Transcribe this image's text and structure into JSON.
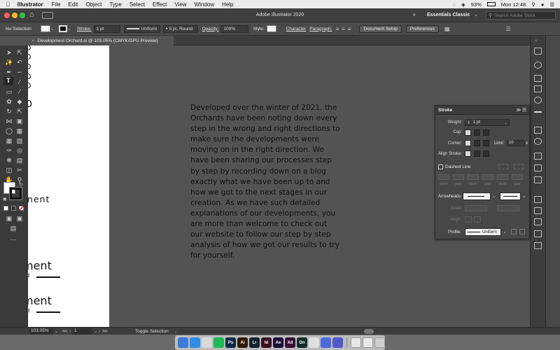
{
  "menubar": {
    "app_name": "Illustrator",
    "items": [
      "File",
      "Edit",
      "Object",
      "Type",
      "Select",
      "Effect",
      "View",
      "Window",
      "Help"
    ],
    "battery": "93%",
    "clock": "Mon 12:48"
  },
  "titlebar": {
    "title": "Adobe Illustrator 2020",
    "workspace": "Essentials Classic",
    "search_placeholder": "Search Adobe Stock"
  },
  "controlbar": {
    "selection": "No Selection",
    "stroke_label": "Stroke:",
    "stroke_weight": "1 pt",
    "profile": "Uniform",
    "brush": "5 pt. Round",
    "opacity_label": "Opacity:",
    "opacity": "100%",
    "style_label": "Style:",
    "character": "Character",
    "paragraph": "Paragraph:",
    "document_setup": "Document Setup",
    "preferences": "Preferences"
  },
  "document": {
    "tab_title": "Development Orchard.ai @ 103.05% (CMYK/GPU Preview)"
  },
  "artboard": {
    "fragments": [
      "D",
      "D",
      "D",
      "D",
      "D",
      "D",
      "nent",
      "ment",
      "d",
      "ment",
      "d"
    ]
  },
  "body_copy": "Developed over the winter of 2021, the Orchards have been noting down every step in the wrong and right directions to make sure the developments were moving on in the right direction. We have been sharing our processes step by step by recording down on a blog exactly what we have been up to and how we got to the next stages in our creation. As we have such detailed explanations of our developments, you are more than welcome to check out our website to follow our step by step analysis of how we got our results to try for yourself.",
  "stroke_panel": {
    "title": "Stroke",
    "weight_label": "Weight:",
    "weight": "1 pt",
    "cap_label": "Cap:",
    "corner_label": "Corner:",
    "limit_label": "Limit:",
    "limit": "10",
    "limit_suffix": "x",
    "align_label": "Align Stroke:",
    "dashed_label": "Dashed Line",
    "dash_labels": [
      "dash",
      "gap",
      "dash",
      "gap",
      "dash",
      "gap"
    ],
    "arrowheads_label": "Arrowheads:",
    "scale_label": "Scale:",
    "align2_label": "Align:",
    "profile_label": "Profile:",
    "profile": "Uniform"
  },
  "statusbar": {
    "zoom": "103.05%",
    "artboard": "1",
    "toggle": "Toggle Selection"
  },
  "dock_icons": [
    {
      "name": "finder-icon",
      "label": "",
      "color": "#3b7bd9"
    },
    {
      "name": "safari-icon",
      "label": "",
      "color": "#2c8ce6"
    },
    {
      "name": "photos-icon",
      "label": "",
      "color": "#d9d9d9"
    },
    {
      "name": "spotify-icon",
      "label": "",
      "color": "#1db954"
    },
    {
      "name": "photoshop-icon",
      "label": "Ps",
      "color": "#0f2a44"
    },
    {
      "name": "illustrator-icon",
      "label": "Ai",
      "color": "#331c00"
    },
    {
      "name": "lightroom-icon",
      "label": "Lr",
      "color": "#0f2333"
    },
    {
      "name": "indesign-icon",
      "label": "Id",
      "color": "#3c0f22"
    },
    {
      "name": "aftereffects-icon",
      "label": "Ae",
      "color": "#1c0f3a"
    },
    {
      "name": "xd-icon",
      "label": "Xd",
      "color": "#3a0f33"
    },
    {
      "name": "dimension-icon",
      "label": "Dn",
      "color": "#0f2e2a"
    },
    {
      "name": "chrome-icon",
      "label": "",
      "color": "#dfdfdf"
    },
    {
      "name": "siri-icon",
      "label": "",
      "color": "#4a6ad9"
    },
    {
      "name": "teams-icon",
      "label": "",
      "color": "#5059c9"
    }
  ],
  "colors": {
    "canvas": "#535353",
    "artboard": "#ffffff",
    "panel": "#474747",
    "red_close": "#ff5f57",
    "yellow_min": "#ffbd2e",
    "green_max": "#28c840"
  }
}
